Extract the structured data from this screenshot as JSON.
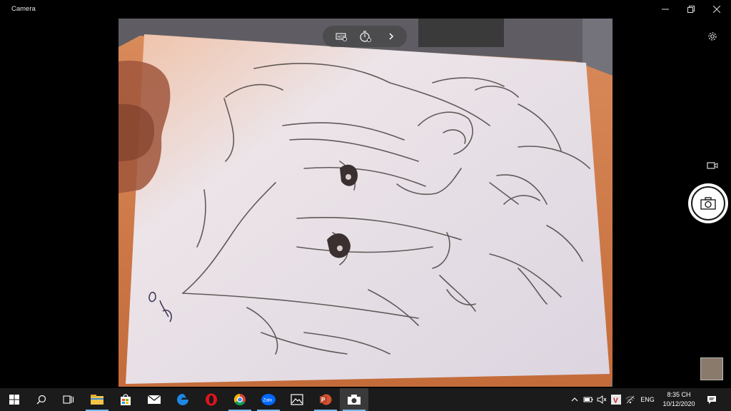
{
  "window": {
    "title": "Camera"
  },
  "taskbar": {
    "apps": [
      "start-icon",
      "search-icon",
      "task-view-icon",
      "file-explorer-icon",
      "store-icon",
      "mail-icon",
      "edge-icon",
      "opera-icon",
      "chrome-icon",
      "zalo-icon",
      "photos-icon",
      "powerpoint-icon",
      "camera-icon"
    ],
    "zalo_label": "Zalo",
    "language": "ENG",
    "time": "8:35 CH",
    "date": "10/12/2020"
  },
  "camera": {
    "controls": [
      "hdr-icon",
      "timer-icon",
      "more-chevron-icon"
    ],
    "shutter_mode": "photo"
  },
  "colors": {
    "taskbar_bg": "#1b1b1b",
    "accent": "#76b9ed",
    "window_bg": "#000000"
  }
}
